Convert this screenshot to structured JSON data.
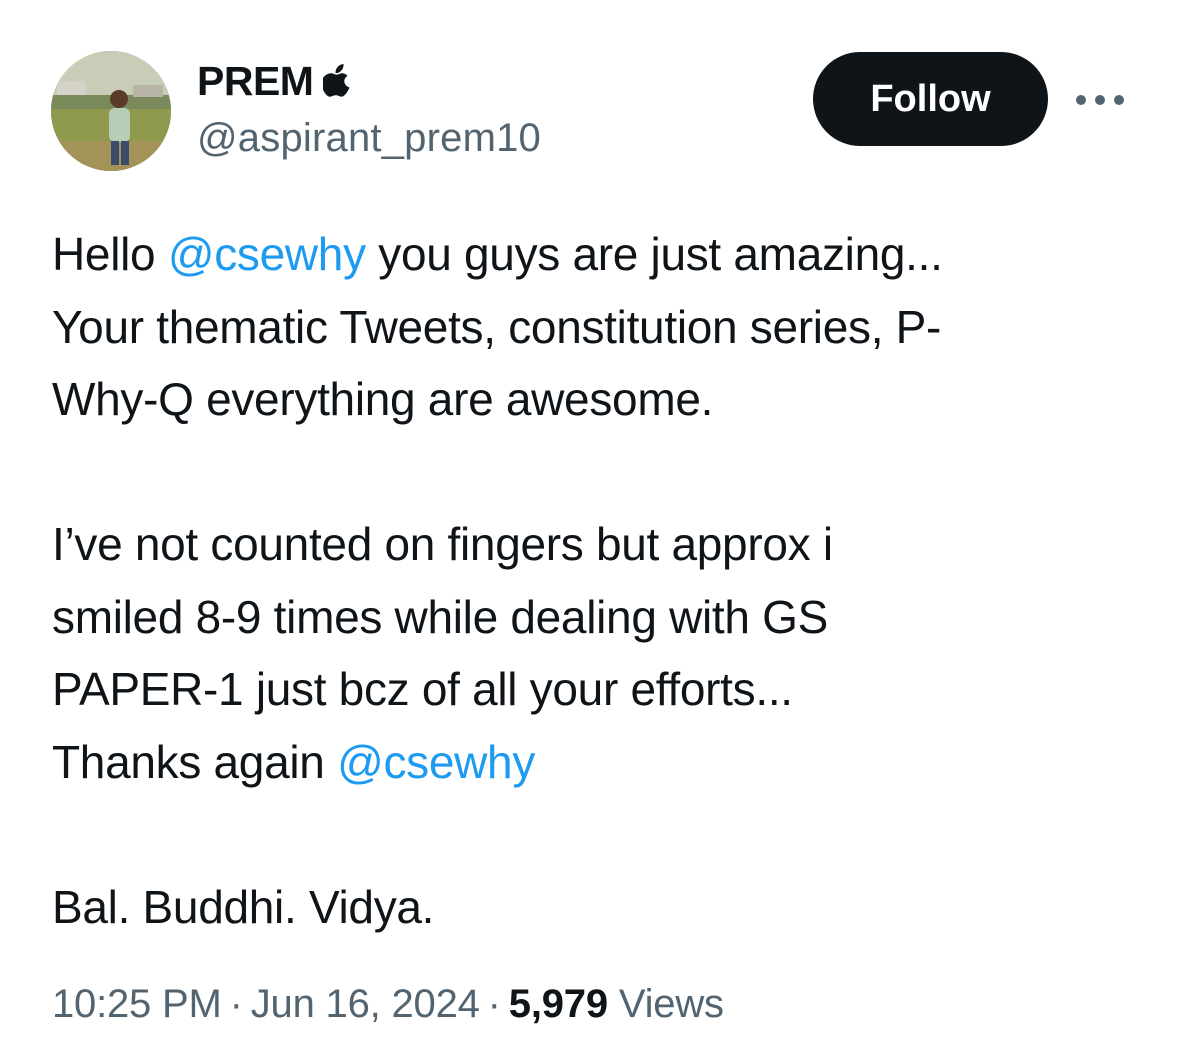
{
  "author": {
    "display_name": "PREM",
    "verified_badge_icon": "apple-logo-icon",
    "handle": "@aspirant_prem10",
    "avatar_icon": "profile-photo-avatar"
  },
  "actions": {
    "follow_label": "Follow",
    "more_icon": "more-horizontal-icon"
  },
  "tweet": {
    "line1": {
      "pre": "Hello ",
      "mention": "@csewhy",
      "post": " you guys are just amazing..."
    },
    "line2": "Your thematic Tweets, constitution series, P-",
    "line3": "Why-Q everything are awesome.",
    "line4": "I’ve not counted on fingers but approx i",
    "line5": "smiled 8-9 times while dealing with GS",
    "line6": "PAPER-1 just bcz of all your efforts...",
    "line7": {
      "pre": "Thanks again ",
      "mention": "@csewhy"
    },
    "line8": "Bal. Buddhi. Vidya."
  },
  "meta": {
    "time": "10:25 PM",
    "separator": "·",
    "date": "Jun 16, 2024",
    "views_count": "5,979",
    "views_label": "Views"
  },
  "colors": {
    "text_primary": "#0f1419",
    "text_secondary": "#536471",
    "link": "#1d9bf0",
    "follow_bg": "#0f1419",
    "follow_text": "#ffffff"
  }
}
